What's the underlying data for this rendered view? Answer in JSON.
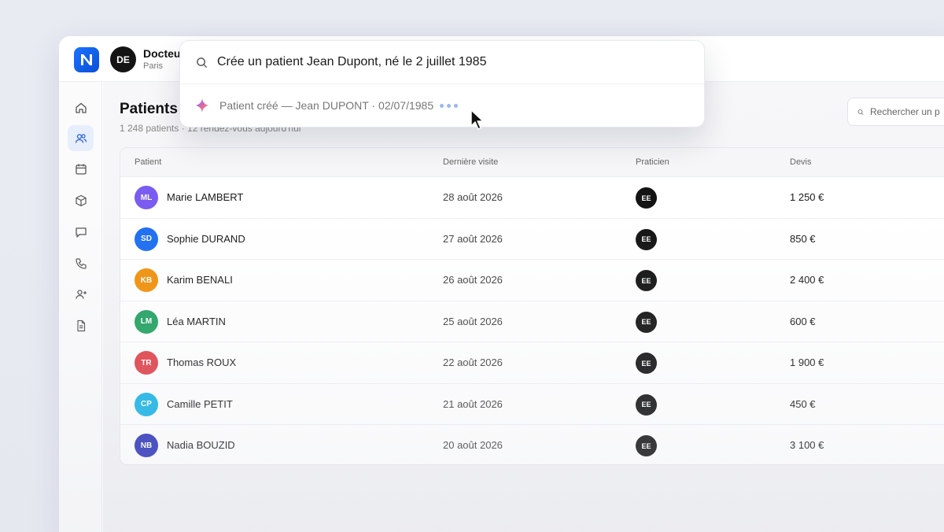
{
  "header": {
    "user_initials": "DE",
    "user_name": "Docteur",
    "user_city": "Paris"
  },
  "sidebar": {
    "items": [
      {
        "icon": "home-icon"
      },
      {
        "icon": "users-icon",
        "active": true
      },
      {
        "icon": "calendar-icon"
      },
      {
        "icon": "box-icon"
      },
      {
        "icon": "chat-icon"
      },
      {
        "icon": "phone-icon"
      },
      {
        "icon": "user-plus-icon"
      },
      {
        "icon": "document-icon"
      }
    ]
  },
  "page": {
    "title": "Patients",
    "subtitle": "1 248 patients · 12 rendez-vous aujourd'hui"
  },
  "search": {
    "placeholder": "Rechercher un p"
  },
  "command": {
    "query": "Crée un patient Jean Dupont, né le 2 juillet 1985",
    "result": "Patient créé — Jean DUPONT · 02/07/1985"
  },
  "table": {
    "headers": {
      "patient": "Patient",
      "visit": "Dernière visite",
      "practitioner": "Praticien",
      "quote": "Devis"
    },
    "rows": [
      {
        "initials": "ML",
        "name": "Marie LAMBERT",
        "visit": "28 août 2026",
        "prat": "EE",
        "devis": "1 250 €",
        "color": "#7b5cf0"
      },
      {
        "initials": "SD",
        "name": "Sophie DURAND",
        "visit": "27 août 2026",
        "prat": "EE",
        "devis": "850 €",
        "color": "#1f6ff2"
      },
      {
        "initials": "KB",
        "name": "Karim BENALI",
        "visit": "26 août 2026",
        "prat": "EE",
        "devis": "2 400 €",
        "color": "#f0920e"
      },
      {
        "initials": "LM",
        "name": "Léa MARTIN",
        "visit": "25 août 2026",
        "prat": "EE",
        "devis": "600 €",
        "color": "#24a263"
      },
      {
        "initials": "TR",
        "name": "Thomas ROUX",
        "visit": "22 août 2026",
        "prat": "EE",
        "devis": "1 900 €",
        "color": "#e0434b"
      },
      {
        "initials": "CP",
        "name": "Camille PETIT",
        "visit": "21 août 2026",
        "prat": "EE",
        "devis": "450 €",
        "color": "#19b3e6"
      },
      {
        "initials": "NB",
        "name": "Nadia BOUZID",
        "visit": "20 août 2026",
        "prat": "EE",
        "devis": "3 100 €",
        "color": "#2c33b8"
      }
    ]
  },
  "colors": {
    "brand": "#1a73ff"
  }
}
